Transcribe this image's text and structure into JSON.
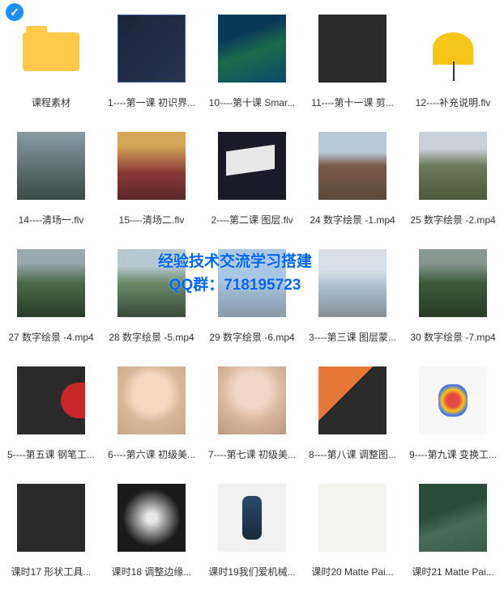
{
  "watermark": {
    "line1": "经验技术交流学习搭建",
    "line2": "QQ群：718195723"
  },
  "items": [
    {
      "label": "课程素材",
      "type": "folder",
      "selected": true
    },
    {
      "label": "1----第一课 初识界...",
      "thumb": "t1"
    },
    {
      "label": "10----第十课 Smar...",
      "thumb": "t2"
    },
    {
      "label": "11----第十一课 剪...",
      "thumb": "t3"
    },
    {
      "label": "12----补充说明.flv",
      "thumb": "t4"
    },
    {
      "label": "14----清场一.flv",
      "thumb": "t5"
    },
    {
      "label": "15----清场二.flv",
      "thumb": "t6"
    },
    {
      "label": "2----第二课 图层.flv",
      "thumb": "t7"
    },
    {
      "label": "24 数字绘景 -1.mp4",
      "thumb": "t8"
    },
    {
      "label": "25 数字绘景 -2.mp4",
      "thumb": "t9"
    },
    {
      "label": "27 数字绘景 -4.mp4",
      "thumb": "t10"
    },
    {
      "label": "28 数字绘景 -5.mp4",
      "thumb": "t11"
    },
    {
      "label": "29 数字绘景 -6.mp4",
      "thumb": "t12"
    },
    {
      "label": "3----第三课 图层蒙...",
      "thumb": "t13"
    },
    {
      "label": "30 数字绘景 -7.mp4",
      "thumb": "t14"
    },
    {
      "label": "5----第五课 钢笔工...",
      "thumb": "t15"
    },
    {
      "label": "6----第六课 初级美...",
      "thumb": "t16"
    },
    {
      "label": "7----第七课 初级美...",
      "thumb": "t17"
    },
    {
      "label": "8----第八课 调整图...",
      "thumb": "t18"
    },
    {
      "label": "9----第九课 变换工...",
      "thumb": "t19"
    },
    {
      "label": "课时17 形状工具...",
      "thumb": "t20"
    },
    {
      "label": "课时18 调整边缘...",
      "thumb": "t21"
    },
    {
      "label": "课时19我们爱机械...",
      "thumb": "t22"
    },
    {
      "label": "课时20 Matte Pai...",
      "thumb": "t23"
    },
    {
      "label": "课时21 Matte Pai...",
      "thumb": "t24"
    }
  ]
}
